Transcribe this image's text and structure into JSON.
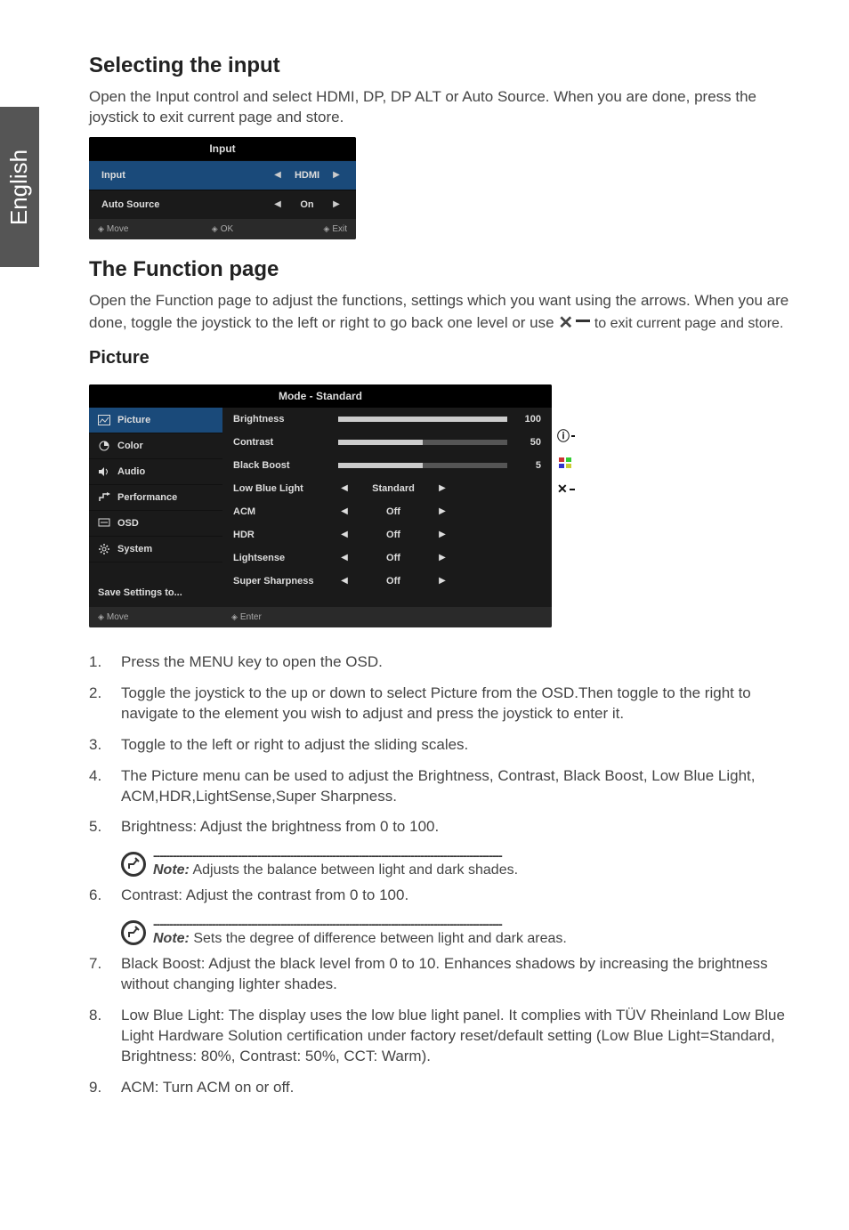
{
  "lang_tab": "English",
  "section1": {
    "title": "Selecting the input",
    "body": "Open the Input control and select HDMI, DP, DP ALT or Auto Source. When you are done, press the joystick to exit current page and store."
  },
  "osd_input": {
    "header": "Input",
    "rows": [
      {
        "label": "Input",
        "value": "HDMI",
        "selected": true
      },
      {
        "label": "Auto Source",
        "value": "On",
        "selected": false
      }
    ],
    "footer": {
      "move": "Move",
      "ok": "OK",
      "exit": "Exit"
    }
  },
  "section2": {
    "title": "The Function page",
    "body1": "Open the Function page to adjust the functions, settings which you want using the arrows. When you are done, toggle the joystick to the left or right to go back one level or use",
    "body2": "to exit current page and store."
  },
  "picture_heading": "Picture",
  "osd_picture": {
    "header": "Mode - Standard",
    "menu": [
      {
        "label": "Picture",
        "selected": true,
        "icon": "picture"
      },
      {
        "label": "Color",
        "selected": false,
        "icon": "color"
      },
      {
        "label": "Audio",
        "selected": false,
        "icon": "audio"
      },
      {
        "label": "Performance",
        "selected": false,
        "icon": "perf"
      },
      {
        "label": "OSD",
        "selected": false,
        "icon": "osd"
      },
      {
        "label": "System",
        "selected": false,
        "icon": "system"
      }
    ],
    "save": "Save Settings to...",
    "settings": [
      {
        "label": "Brightness",
        "type": "bar",
        "value": 100,
        "pct": 100
      },
      {
        "label": "Contrast",
        "type": "bar",
        "value": 50,
        "pct": 50
      },
      {
        "label": "Black Boost",
        "type": "bar",
        "value": 5,
        "pct": 50
      },
      {
        "label": "Low Blue Light",
        "type": "opt",
        "value": "Standard"
      },
      {
        "label": "ACM",
        "type": "opt",
        "value": "Off"
      },
      {
        "label": "HDR",
        "type": "opt",
        "value": "Off"
      },
      {
        "label": "Lightsense",
        "type": "opt",
        "value": "Off"
      },
      {
        "label": "Super Sharpness",
        "type": "opt",
        "value": "Off"
      }
    ],
    "super_sharp_label": "Super Sharpness",
    "footer": {
      "move": "Move",
      "enter": "Enter"
    }
  },
  "steps": [
    "Press the MENU key to open the OSD.",
    "Toggle the joystick to the up or down to select Picture from the OSD.Then toggle to the right to navigate to the element you wish to adjust and press the joystick to enter it.",
    "Toggle to the left or right to adjust the sliding scales.",
    "The Picture menu can be used to adjust the Brightness, Contrast, Black Boost, Low Blue Light, ACM,HDR,LightSense,Super Sharpness.",
    "Brightness: Adjust the brightness from 0 to 100.",
    "Contrast: Adjust the contrast from 0 to 100.",
    "Black Boost: Adjust the black level from 0 to 10. Enhances shadows by increasing the brightness without changing lighter shades.",
    "Low Blue Light: The display uses the low blue light panel. It complies with TÜV Rheinland Low Blue Light Hardware Solution certification under factory reset/default setting (Low Blue Light=Standard, Brightness: 80%, Contrast: 50%, CCT: Warm).",
    "ACM: Turn ACM on or off."
  ],
  "notes": {
    "n5": {
      "label": "Note:",
      "text": " Adjusts the balance between light and dark shades."
    },
    "n6": {
      "label": "Note:",
      "text": " Sets the degree of difference between light and dark areas."
    }
  }
}
